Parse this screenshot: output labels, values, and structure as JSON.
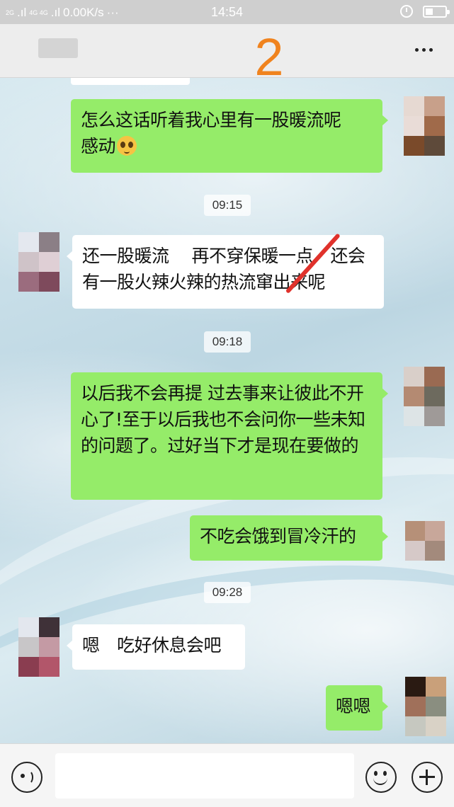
{
  "status_bar": {
    "signal_left": "2G",
    "signal_mid": "4G 4G",
    "speed": "0.00K/s",
    "dots": "···",
    "time": "14:54"
  },
  "header": {
    "annotation_number": "2",
    "more_icon": "more-dots-icon"
  },
  "messages": [
    {
      "type": "sent",
      "text_line1": "怎么这话听着我心里有一股暖流呢",
      "text_line2": "感动",
      "emoji": "touched-emoji-icon"
    },
    {
      "type": "time",
      "text": "09:15"
    },
    {
      "type": "received",
      "text": "还一股暖流　 再不穿保暖一点　还会有一股火辣火辣的热流窜出来呢"
    },
    {
      "type": "time",
      "text": "09:18"
    },
    {
      "type": "sent",
      "text": "以后我不会再提 过去事来让彼此不开心了!至于以后我也不会问你一些未知的问题了。过好当下才是现在要做的"
    },
    {
      "type": "sent",
      "text": "不吃会饿到冒冷汗的"
    },
    {
      "type": "time",
      "text": "09:28"
    },
    {
      "type": "received",
      "text": "嗯　吃好休息会吧"
    },
    {
      "type": "sent",
      "text": "嗯嗯"
    }
  ],
  "input_bar": {
    "voice_icon": "voice-icon",
    "input_value": "",
    "emoji_icon": "emoji-icon",
    "plus_icon": "plus-icon"
  },
  "colors": {
    "sent_bubble": "#95ec69",
    "received_bubble": "#ffffff",
    "annotation": "#f0831e",
    "strike": "#e0322c"
  }
}
